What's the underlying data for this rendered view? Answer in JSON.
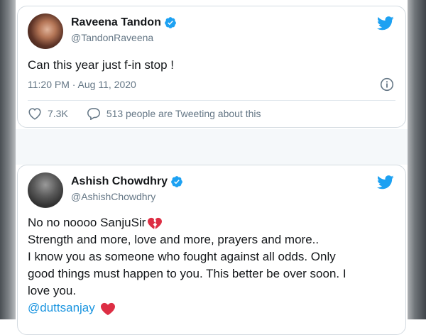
{
  "tweets": [
    {
      "name": "Raveena Tandon",
      "handle": "@TandonRaveena",
      "text": "Can this year just f-in stop !",
      "timestamp": "11:20 PM · Aug 11, 2020",
      "likes": "7.3K",
      "tweeting": "513 people are Tweeting about this"
    },
    {
      "name": "Ashish Chowdhry",
      "handle": "@AshishChowdhry",
      "lines": [
        "No no noooo SanjuSir",
        "Strength and more, love and more, prayers and more..",
        "I know you as someone who fought against all odds. Only",
        "good things must happen to you. This better be over soon. I",
        "love you."
      ],
      "mention": "@duttsanjay"
    }
  ],
  "colors": {
    "twitter_blue": "#1da1f2",
    "verified_blue": "#1da1f2",
    "mention_blue": "#1b95e0",
    "heart_red": "#e0245e",
    "muted_text": "#657786"
  },
  "icons": [
    "verified-badge-icon",
    "twitter-bird-icon",
    "info-icon",
    "heart-outline-icon",
    "reply-bubble-icon",
    "broken-heart-emoji",
    "red-heart-emoji"
  ]
}
